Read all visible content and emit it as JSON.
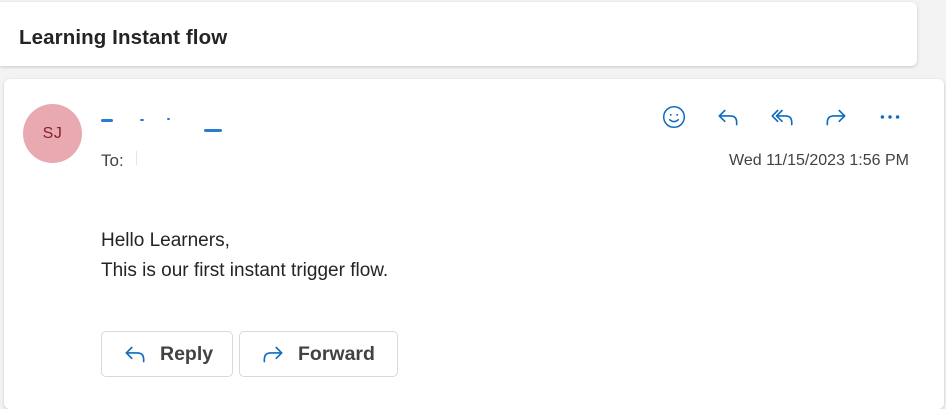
{
  "subject": {
    "title": "Learning Instant flow"
  },
  "message": {
    "avatar_initials": "SJ",
    "to_label": "To:",
    "timestamp": "Wed 11/15/2023 1:56 PM",
    "body_lines": [
      "Hello Learners,",
      "This is our first instant trigger flow."
    ],
    "actions": [
      {
        "name": "emoji-icon"
      },
      {
        "name": "reply-icon"
      },
      {
        "name": "reply-all-icon"
      },
      {
        "name": "forward-icon"
      },
      {
        "name": "more-icon"
      }
    ]
  },
  "footer": {
    "reply_label": "Reply",
    "forward_label": "Forward"
  },
  "colors": {
    "accent": "#0f6cbd",
    "avatar_bg": "#e9a9b0",
    "avatar_text": "#8a1f2d"
  }
}
